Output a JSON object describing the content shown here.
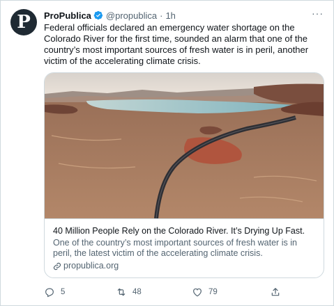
{
  "tweet": {
    "avatar_letter": "P",
    "author_name": "ProPublica",
    "handle": "@propublica",
    "separator": "·",
    "time": "1h",
    "more_label": "···",
    "text": "Federal officials declared an emergency water shortage on the Colorado River for the first time, sounded an alarm that one of the country’s most important sources of fresh water is in peril, another victim of the accelerating climate crisis."
  },
  "card": {
    "title": "40 Million People Rely on the Colorado River. It’s Drying Up Fast.",
    "description": "One of the country’s most important sources of fresh water is in peril, the latest victim of the accelerating climate crisis.",
    "domain": "propublica.org"
  },
  "actions": {
    "reply_count": "5",
    "retweet_count": "48",
    "like_count": "79"
  },
  "colors": {
    "verified": "#1d9bf0",
    "secondary_text": "#536471",
    "border": "#cfd9de"
  },
  "icons": [
    "verified-badge-icon",
    "more-icon",
    "link-icon",
    "reply-icon",
    "retweet-icon",
    "like-icon",
    "share-icon"
  ]
}
